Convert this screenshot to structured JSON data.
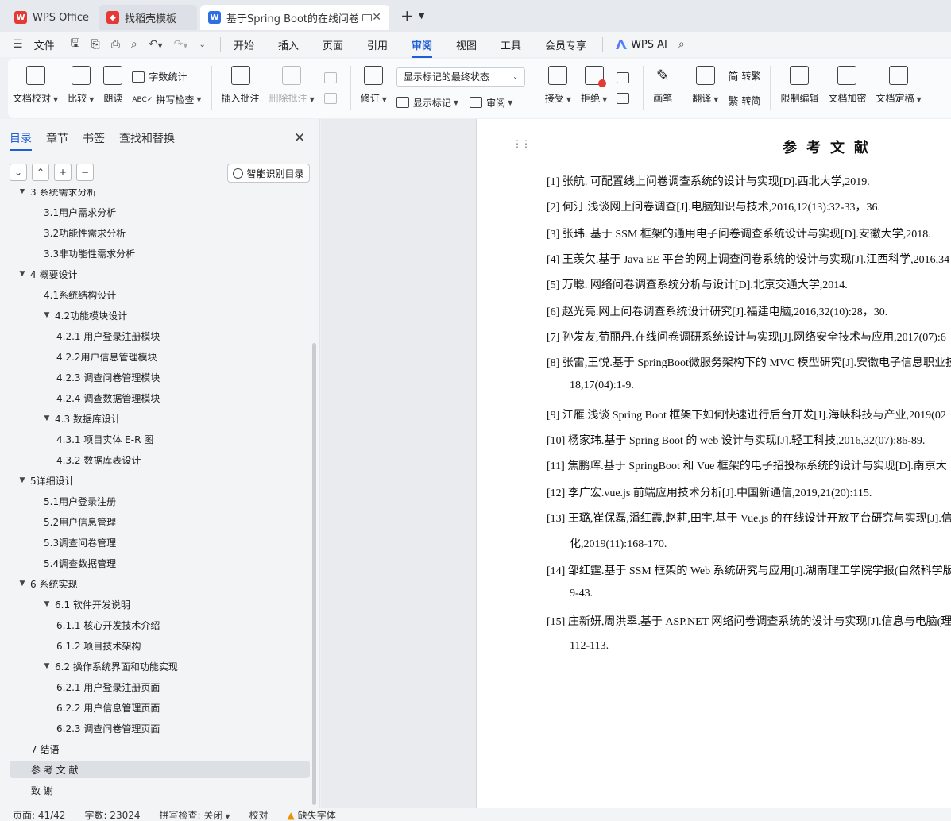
{
  "tabs": [
    {
      "label": "WPS Office",
      "icon": "wps-logo-icon"
    },
    {
      "label": "找稻壳模板",
      "icon": "daoke-icon"
    },
    {
      "label": "基于Spring Boot的在线问卷",
      "icon": "word-doc-icon",
      "active": true
    }
  ],
  "menubar": {
    "file": "文件",
    "items": [
      "开始",
      "插入",
      "页面",
      "引用",
      "审阅",
      "视图",
      "工具",
      "会员专享"
    ],
    "active": "审阅",
    "ai": "WPS AI"
  },
  "ribbon": {
    "proofread": "文档校对",
    "compare": "比较",
    "read_aloud": "朗读",
    "word_count": "字数统计",
    "spell_check": "拼写检查",
    "insert_comment": "插入批注",
    "delete_comment": "删除批注",
    "revise": "修订",
    "markup_state": "显示标记的最终状态",
    "show_markup": "显示标记",
    "review": "审阅",
    "accept": "接受",
    "reject": "拒绝",
    "pen": "画笔",
    "translate": "翻译",
    "to_traditional": "转繁",
    "to_simplified": "转简",
    "restrict_edit": "限制编辑",
    "encrypt": "文档加密",
    "finalize": "文档定稿"
  },
  "nav": {
    "tabs": [
      "目录",
      "章节",
      "书签",
      "查找和替换"
    ],
    "active_tab": "目录",
    "smart_toc": "智能识别目录",
    "toc": [
      {
        "label": "3   系统需求分析",
        "level": 0,
        "expanded": true
      },
      {
        "label": "3.1用户需求分析",
        "level": 1
      },
      {
        "label": "3.2功能性需求分析",
        "level": 1
      },
      {
        "label": "3.3非功能性需求分析",
        "level": 1
      },
      {
        "label": "4   概要设计",
        "level": 0,
        "expanded": true
      },
      {
        "label": "4.1系统结构设计",
        "level": 1
      },
      {
        "label": "4.2功能模块设计",
        "level": 1,
        "expanded": true
      },
      {
        "label": "4.2.1  用户登录注册模块",
        "level": 2
      },
      {
        "label": "4.2.2用户信息管理模块",
        "level": 2
      },
      {
        "label": "4.2.3  调查问卷管理模块",
        "level": 2
      },
      {
        "label": "4.2.4  调查数据管理模块",
        "level": 2
      },
      {
        "label": "4.3    数据库设计",
        "level": 1,
        "expanded": true
      },
      {
        "label": "4.3.1    项目实体 E-R 图",
        "level": 2
      },
      {
        "label": "4.3.2    数据库表设计",
        "level": 2
      },
      {
        "label": "5详细设计",
        "level": 0,
        "expanded": true
      },
      {
        "label": "5.1用户登录注册",
        "level": 1
      },
      {
        "label": "5.2用户信息管理",
        "level": 1
      },
      {
        "label": "5.3调查问卷管理",
        "level": 1
      },
      {
        "label": "5.4调查数据管理",
        "level": 1
      },
      {
        "label": "6    系统实现",
        "level": 0,
        "expanded": true
      },
      {
        "label": "6.1    软件开发说明",
        "level": 1,
        "expanded": true
      },
      {
        "label": "6.1.1    核心开发技术介绍",
        "level": 2
      },
      {
        "label": "6.1.2    项目技术架构",
        "level": 2
      },
      {
        "label": "6.2    操作系统界面和功能实现",
        "level": 1,
        "expanded": true
      },
      {
        "label": "6.2.1    用户登录注册页面",
        "level": 2
      },
      {
        "label": "6.2.2    用户信息管理页面",
        "level": 2
      },
      {
        "label": "6.2.3    调查问卷管理页面",
        "level": 2
      },
      {
        "label": "7    结语",
        "level": 0
      },
      {
        "label": "参  考  文  献",
        "level": 0,
        "selected": true
      },
      {
        "label": "致          谢",
        "level": 0
      }
    ]
  },
  "document": {
    "title": "参考文献",
    "refs": [
      "[1] 张航. 可配置线上问卷调查系统的设计与实现[D].西北大学,2019.",
      "[2] 何汀.浅谈网上问卷调查[J].电脑知识与技术,2016,12(13):32-33，36.",
      "[3] 张玮. 基于 SSM 框架的通用电子问卷调查系统设计与实现[D].安徽大学,2018.",
      "[4] 王羡欠.基于 Java  EE 平台的网上调查问卷系统的设计与实现[J].江西科学,2016,34",
      "[5] 万聪. 网络问卷调查系统分析与设计[D].北京交通大学,2014.",
      "[6] 赵光亮.网上问卷调查系统设计研究[J].福建电脑,2016,32(10):28，30.",
      "[7]  孙发友,荀丽丹.在线问卷调研系统设计与实现[J].网络安全技术与应用,2017(07):6",
      "[8] 张雷,王悦.基于 SpringBoot微服务架构下的 MVC 模型研究[J].安徽电子信息职业技",
      "18,17(04):1-9.",
      "[9] 江雁.浅谈 Spring  Boot 框架下如何快速进行后台开发[J].海峡科技与产业,2019(02",
      "[10] 杨家玮.基于 Spring  Boot 的 web 设计与实现[J].轻工科技,2016,32(07):86-89.",
      "[11] 焦鹏珲.基于 SpringBoot 和 Vue 框架的电子招投标系统的设计与实现[D].南京大",
      "[12] 李广宏.vue.js 前端应用技术分析[J].中国新通信,2019,21(20):115.",
      "[13] 王璐,崔保磊,潘红霞,赵莉,田宇.基于 Vue.js 的在线设计开放平台研究与实现[J].信",
      "化,2019(11):168-170.",
      "[14] 邹红霆.基于 SSM 框架的 Web 系统研究与应用[J].湖南理工学院学报(自然科学版",
      "9-43.",
      "[15] 庄新妍,周洪翠.基于 ASP.NET 网络问卷调查系统的设计与实现[J].信息与电脑(理",
      "112-113."
    ]
  },
  "status": {
    "page": "页面: 41/42",
    "words": "字数: 23024",
    "spell": "拼写检查: 关闭",
    "proof": "校对",
    "missing_font": "缺失字体"
  },
  "colors": {
    "accent": "#1f5fd6",
    "wps_red": "#e53935",
    "word_blue": "#2f6fe4"
  }
}
